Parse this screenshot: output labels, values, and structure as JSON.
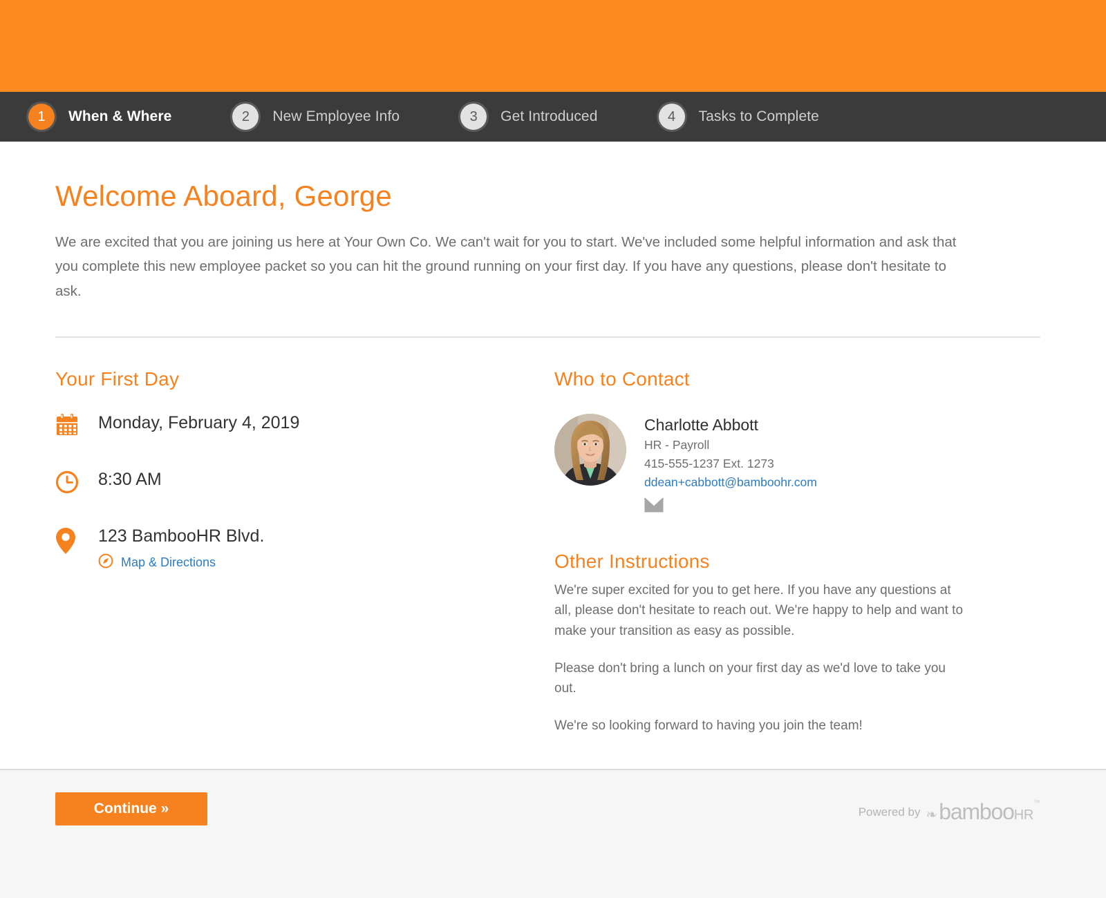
{
  "brand": {
    "accent_orange": "#F5821F",
    "band_orange": "#FB8B1E",
    "nav_dark": "#3B3B3B",
    "link_blue": "#2C7CC1",
    "body_gray": "#6E6E6E"
  },
  "steps": [
    {
      "number": "1",
      "label": "When & Where",
      "active": true
    },
    {
      "number": "2",
      "label": "New Employee Info",
      "active": false
    },
    {
      "number": "3",
      "label": "Get Introduced",
      "active": false
    },
    {
      "number": "4",
      "label": "Tasks to Complete",
      "active": false
    }
  ],
  "main": {
    "title": "Welcome Aboard, George",
    "intro": "We are excited that you are joining us here at Your Own Co. We can't wait for you to start. We've included some helpful information and ask that you complete this new employee packet so you can hit the ground running on your first day. If you have any questions, please don't hesitate to ask."
  },
  "first_day": {
    "heading": "Your First Day",
    "date": "Monday, February 4, 2019",
    "time": "8:30 AM",
    "address": "123 BambooHR Blvd.",
    "map_link": "Map & Directions",
    "icons": {
      "date": "calendar-icon",
      "time": "clock-icon",
      "address": "map-pin-icon",
      "map_link": "compass-icon"
    }
  },
  "contact": {
    "heading": "Who to Contact",
    "name": "Charlotte Abbott",
    "role": "HR - Payroll",
    "phone": "415-555-1237 Ext. 1273",
    "email": "ddean+cabbott@bamboohr.com",
    "email_icon": "envelope-icon",
    "avatar_alt": "Charlotte Abbott headshot"
  },
  "instructions": {
    "heading": "Other Instructions",
    "paragraphs": [
      "We're super excited for you to get here. If you have any questions at all, please don't hesitate to reach out. We're happy to help and want to make your transition as easy as possible.",
      "Please don't bring a lunch on your first day as we'd love to take you out.",
      "We're so looking forward to having you join the team!"
    ]
  },
  "footer": {
    "continue_label": "Continue »",
    "powered_by": "Powered by",
    "logo_word": "bamboo",
    "logo_suffix": "HR",
    "logo_tm": "™"
  }
}
